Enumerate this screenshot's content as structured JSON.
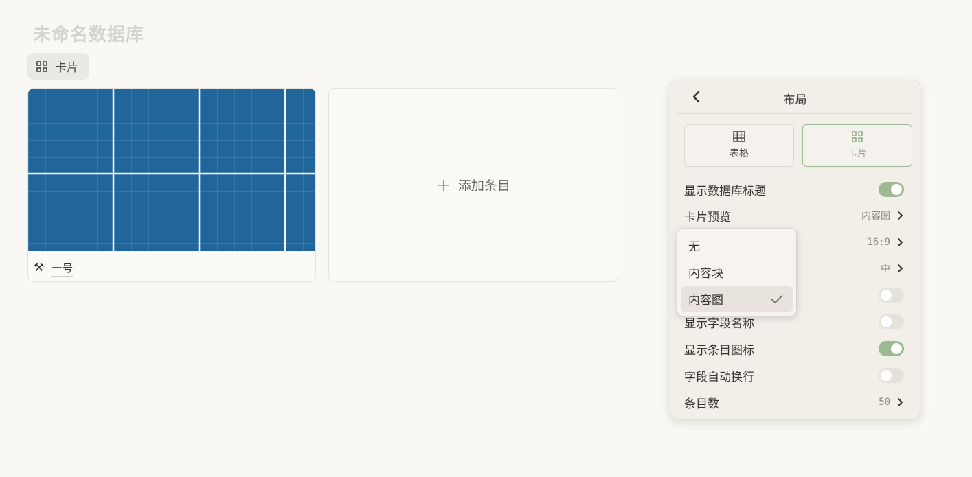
{
  "database": {
    "title": "未命名数据库"
  },
  "view_tab": {
    "label": "卡片",
    "icon": "grid-icon"
  },
  "card": {
    "name": "一号",
    "icon": "hammer-and-pick-icon",
    "cover_color": "#21669b"
  },
  "add_card": {
    "label": "添加条目"
  },
  "panel": {
    "title": "布局",
    "layouts": [
      {
        "label": "表格",
        "icon": "table-icon"
      },
      {
        "label": "卡片",
        "icon": "grid-icon",
        "selected": true
      }
    ],
    "rows": [
      {
        "label": "显示数据库标题",
        "toggle": true
      },
      {
        "label": "卡片预览",
        "value": "内容图"
      },
      {
        "label": "",
        "value": "16:9"
      },
      {
        "label": "",
        "value": "中"
      },
      {
        "label": "",
        "toggle": false
      },
      {
        "label": "显示字段名称",
        "toggle": false
      },
      {
        "label": "显示条目图标",
        "toggle": true
      },
      {
        "label": "字段自动换行",
        "toggle": false
      },
      {
        "label": "条目数",
        "value": "50"
      }
    ]
  },
  "dropdown": {
    "options": [
      {
        "label": "无"
      },
      {
        "label": "内容块"
      },
      {
        "label": "内容图",
        "selected": true
      }
    ]
  },
  "colors": {
    "accent_green": "#9cb993",
    "background": "#f9f8f4"
  }
}
